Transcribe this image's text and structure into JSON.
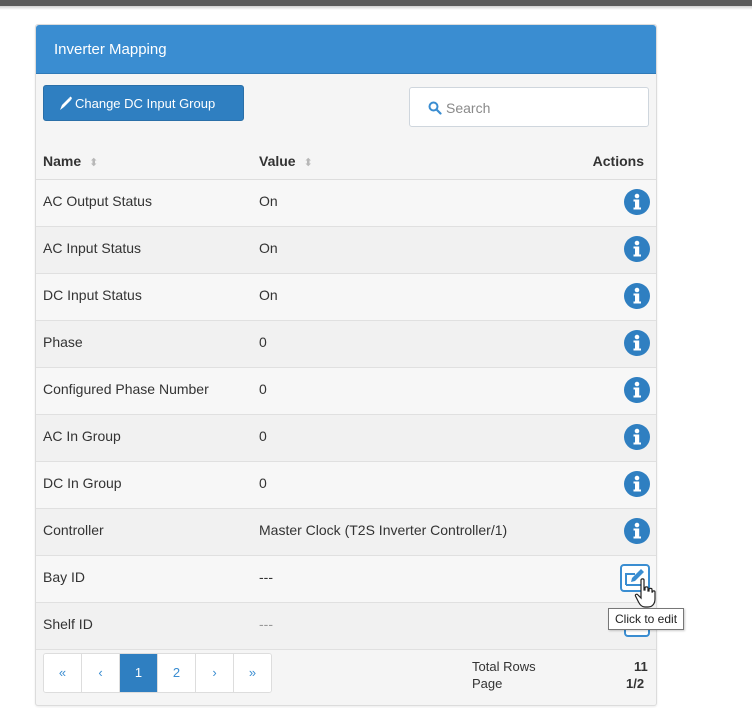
{
  "panel": {
    "title": "Inverter Mapping"
  },
  "toolbar": {
    "change_group_label": "Change DC Input Group"
  },
  "search": {
    "placeholder": "Search",
    "value": ""
  },
  "columns": {
    "name": "Name",
    "value": "Value",
    "actions": "Actions"
  },
  "rows": [
    {
      "name": "AC Output Status",
      "value": "On",
      "action": "info"
    },
    {
      "name": "AC Input Status",
      "value": "On",
      "action": "info"
    },
    {
      "name": "DC Input Status",
      "value": "On",
      "action": "info"
    },
    {
      "name": "Phase",
      "value": "0",
      "action": "info"
    },
    {
      "name": "Configured Phase Number",
      "value": "0",
      "action": "info"
    },
    {
      "name": "AC In Group",
      "value": "0",
      "action": "info"
    },
    {
      "name": "DC In Group",
      "value": "0",
      "action": "info"
    },
    {
      "name": "Controller",
      "value": "Master Clock (T2S Inverter Controller/1)",
      "action": "info"
    },
    {
      "name": "Bay ID",
      "value": "---",
      "action": "edit"
    },
    {
      "name": "Shelf ID",
      "value": "---",
      "action": "edit"
    }
  ],
  "tooltip": {
    "text": "Click to edit"
  },
  "pagination": {
    "first": "«",
    "prev": "‹",
    "pages": [
      "1",
      "2"
    ],
    "current": "1",
    "next": "›",
    "last": "»"
  },
  "footer": {
    "total_rows_label": "Total Rows",
    "total_rows": "11",
    "page_label": "Page",
    "page": "1/2"
  },
  "colors": {
    "primary": "#3a8dd1",
    "button": "#2f7fc1",
    "info_icon": "#2f7fc1"
  },
  "icons": {
    "action_info": "info-circle-icon",
    "action_edit": "edit-icon",
    "search": "search-icon",
    "toolbar": "pencil-icon"
  }
}
